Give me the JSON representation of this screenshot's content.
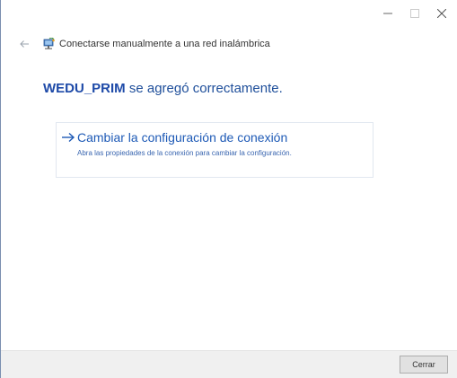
{
  "window": {
    "controls": {
      "minimize_icon": "minimize-icon",
      "maximize_icon": "maximize-icon",
      "close_icon": "close-icon"
    }
  },
  "header": {
    "back_icon": "back-arrow-icon",
    "network_icon": "wireless-network-icon",
    "title": "Conectarse manualmente a una red inalámbrica"
  },
  "main": {
    "network_name": "WEDU_PRIM",
    "success_suffix": " se agregó correctamente.",
    "option": {
      "arrow_icon": "right-arrow-icon",
      "title": "Cambiar la configuración de conexión",
      "description": "Abra las propiedades de la conexión para cambiar la configuración."
    }
  },
  "footer": {
    "close_label": "Cerrar"
  },
  "colors": {
    "accent": "#1e5ab6",
    "success_text": "#1e4e9a",
    "footer_bg": "#f0f0f0"
  }
}
